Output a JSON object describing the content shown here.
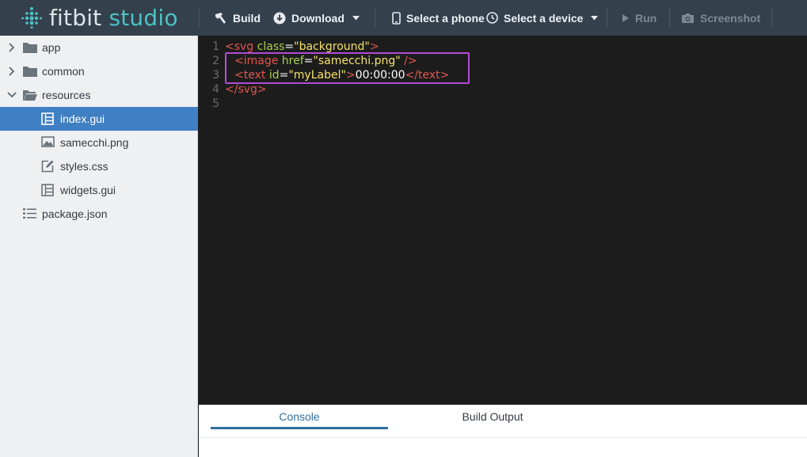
{
  "app": {
    "logo_text_primary": "fitbit",
    "logo_text_secondary": "studio",
    "accent_color": "#4cc2c4"
  },
  "toolbar": {
    "build_label": "Build",
    "download_label": "Download",
    "select_phone_label": "Select a phone",
    "select_device_label": "Select a device",
    "run_label": "Run",
    "screenshot_label": "Screenshot",
    "icons": [
      "hammer-icon",
      "download-icon",
      "phone-icon",
      "watch-icon",
      "play-icon",
      "camera-icon"
    ]
  },
  "sidebar": {
    "items": [
      {
        "label": "app",
        "type": "folder",
        "expanded": false
      },
      {
        "label": "common",
        "type": "folder",
        "expanded": false
      },
      {
        "label": "resources",
        "type": "folder",
        "expanded": true
      },
      {
        "label": "index.gui",
        "type": "gui-file",
        "selected": true
      },
      {
        "label": "samecchi.png",
        "type": "image-file"
      },
      {
        "label": "styles.css",
        "type": "css-file"
      },
      {
        "label": "widgets.gui",
        "type": "gui-file"
      },
      {
        "label": "package.json",
        "type": "json-file"
      }
    ],
    "selected_color": "#3f7fc3"
  },
  "editor": {
    "line_numbers": [
      "1",
      "2",
      "3",
      "4",
      "5"
    ],
    "lines": {
      "l1": {
        "open": "<svg",
        "attr": "class",
        "eq": "=",
        "val": "\"background\"",
        "close": ">"
      },
      "l2": {
        "open": "<image",
        "attr": "href",
        "eq": "=",
        "val": "\"samecchi.png\"",
        "close": " />"
      },
      "l3": {
        "open": "<text",
        "attr": "id",
        "eq": "=",
        "val": "\"myLabel\"",
        "close": ">",
        "content": "00:00:00",
        "end": "</text>"
      },
      "l4": {
        "end": "</svg>"
      }
    },
    "highlight_color": "#b24bd6"
  },
  "bottom_panel": {
    "tabs": [
      {
        "label": "Console",
        "active": true
      },
      {
        "label": "Build Output",
        "active": false
      }
    ]
  }
}
